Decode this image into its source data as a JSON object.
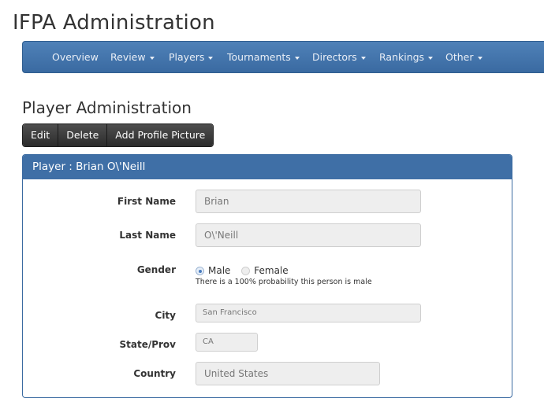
{
  "app": {
    "title": "IFPA Administration"
  },
  "nav": {
    "items": [
      {
        "label": "Overview",
        "dropdown": false
      },
      {
        "label": "Review",
        "dropdown": true
      },
      {
        "label": "Players",
        "dropdown": true
      },
      {
        "label": "Tournaments",
        "dropdown": true
      },
      {
        "label": "Directors",
        "dropdown": true
      },
      {
        "label": "Rankings",
        "dropdown": true
      },
      {
        "label": "Other",
        "dropdown": true
      }
    ]
  },
  "page": {
    "title": "Player Administration"
  },
  "toolbar": {
    "edit_label": "Edit",
    "delete_label": "Delete",
    "add_picture_label": "Add Profile Picture"
  },
  "panel": {
    "heading": "Player : Brian O\\'Neill"
  },
  "form": {
    "first_name": {
      "label": "First Name",
      "value": "Brian"
    },
    "last_name": {
      "label": "Last Name",
      "value": "O\\'Neill"
    },
    "gender": {
      "label": "Gender",
      "options": [
        "Male",
        "Female"
      ],
      "selected": "Male",
      "help": "There is a 100% probability this person is male"
    },
    "city": {
      "label": "City",
      "value": "San Francisco"
    },
    "state": {
      "label": "State/Prov",
      "value": "CA"
    },
    "country": {
      "label": "Country",
      "value": "United States"
    }
  },
  "colors": {
    "navbar": "#4577ae",
    "panel_heading": "#3f6fa6",
    "button": "#3a3a3a",
    "field_bg": "#eeeeee"
  }
}
